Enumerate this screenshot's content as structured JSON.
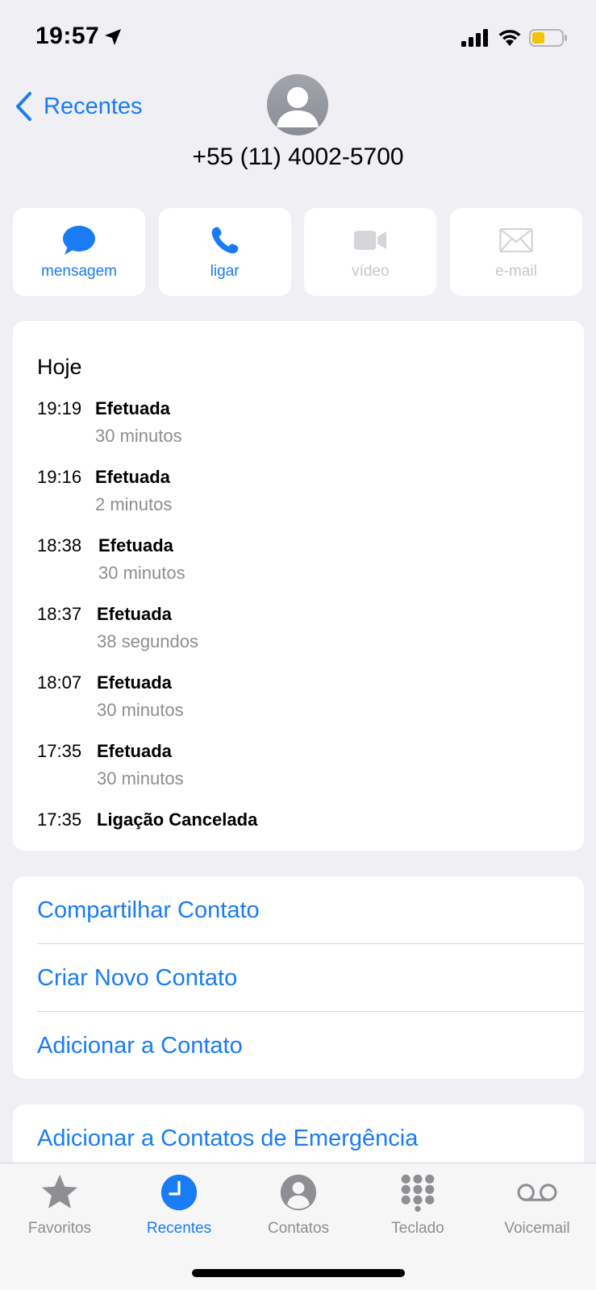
{
  "status_bar": {
    "time": "19:57"
  },
  "nav": {
    "back_label": "Recentes"
  },
  "contact": {
    "phone_number": "+55 (11) 4002-5700"
  },
  "actions": [
    {
      "label": "mensagem",
      "icon": "message-icon",
      "enabled": true
    },
    {
      "label": "ligar",
      "icon": "phone-icon",
      "enabled": true
    },
    {
      "label": "vídeo",
      "icon": "video-icon",
      "enabled": false
    },
    {
      "label": "e-mail",
      "icon": "mail-icon",
      "enabled": false
    }
  ],
  "history": {
    "date_label": "Hoje",
    "calls": [
      {
        "time": "19:19",
        "type": "Efetuada",
        "duration": "30 minutos"
      },
      {
        "time": "19:16",
        "type": "Efetuada",
        "duration": "2 minutos"
      },
      {
        "time": "18:38",
        "type": "Efetuada",
        "duration": "30 minutos"
      },
      {
        "time": "18:37",
        "type": "Efetuada",
        "duration": "38 segundos"
      },
      {
        "time": "18:07",
        "type": "Efetuada",
        "duration": "30 minutos"
      },
      {
        "time": "17:35",
        "type": "Efetuada",
        "duration": "30 minutos"
      },
      {
        "time": "17:35",
        "type": "Ligação Cancelada",
        "duration": ""
      }
    ]
  },
  "options": {
    "share_contact": "Compartilhar Contato",
    "create_contact": "Criar Novo Contato",
    "add_to_contact": "Adicionar a Contato",
    "add_emergency": "Adicionar a Contatos de Emergência"
  },
  "tabbar": {
    "tabs": [
      {
        "label": "Favoritos",
        "icon": "star-icon",
        "active": false
      },
      {
        "label": "Recentes",
        "icon": "clock-icon",
        "active": true
      },
      {
        "label": "Contatos",
        "icon": "person-icon",
        "active": false
      },
      {
        "label": "Teclado",
        "icon": "keypad-icon",
        "active": false
      },
      {
        "label": "Voicemail",
        "icon": "voicemail-icon",
        "active": false
      }
    ]
  },
  "colors": {
    "accent": "#1a7cf5",
    "background": "#efeff4",
    "secondary_text": "#8e8e93",
    "battery_low": "#f5c400"
  }
}
